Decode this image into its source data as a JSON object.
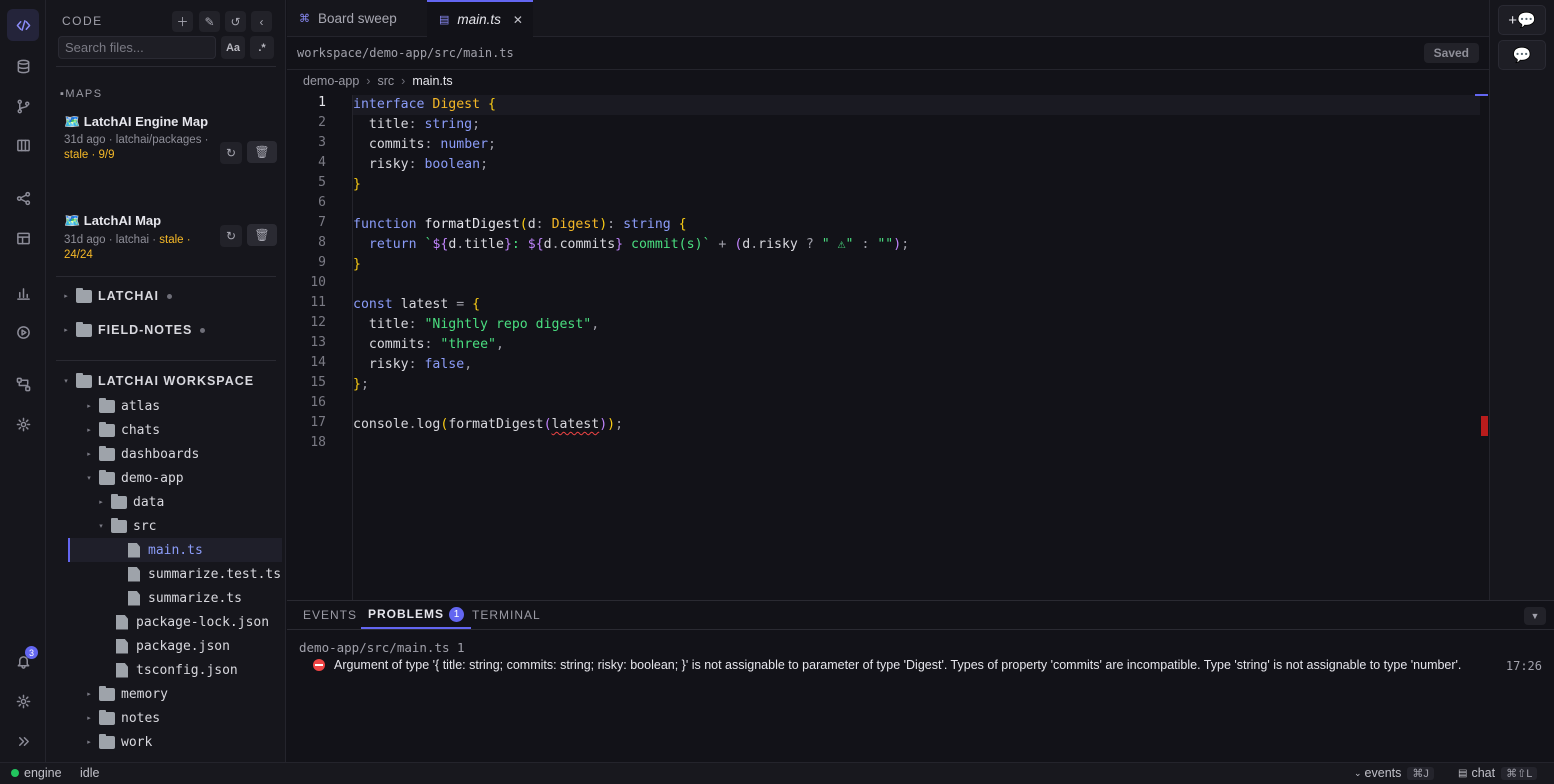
{
  "activity_bar": {
    "items": [
      "code-icon",
      "database-icon",
      "git-branch-icon",
      "board-icon",
      "share-icon",
      "dashboard-icon",
      "chart-icon",
      "play-icon",
      "flow-icon",
      "gear-icon"
    ],
    "notifications_count": "3"
  },
  "sidebar": {
    "title": "CODE",
    "search_placeholder": "Search files...",
    "match_case": "Aa",
    "regex": ".*",
    "maps_label": "MAPS",
    "maps": [
      {
        "title": "🗺️ LatchAI Engine Map",
        "meta_prefix": "31d ago · latchai/packages · ",
        "stale": "stale",
        "meta_sep": " · ",
        "count": "9/9"
      },
      {
        "title": "🗺️ LatchAI Map",
        "meta_prefix": "31d ago · latchai · ",
        "stale": "stale",
        "meta_sep": " · ",
        "count": "24/24"
      }
    ],
    "groups": [
      "LATCHAI",
      "FIELD-NOTES",
      "LATCHAI WORKSPACE"
    ],
    "tree": [
      {
        "label": "atlas"
      },
      {
        "label": "chats"
      },
      {
        "label": "dashboards"
      },
      {
        "label": "demo-app"
      },
      {
        "label": "data"
      },
      {
        "label": "src"
      },
      {
        "label": "main.ts"
      },
      {
        "label": "summarize.test.ts"
      },
      {
        "label": "summarize.ts"
      },
      {
        "label": "package-lock.json"
      },
      {
        "label": "package.json"
      },
      {
        "label": "tsconfig.json"
      },
      {
        "label": "memory"
      },
      {
        "label": "notes"
      },
      {
        "label": "work"
      }
    ]
  },
  "tabs": [
    {
      "label": "Board sweep"
    },
    {
      "label": "main.ts",
      "close": "✕"
    }
  ],
  "pathbar": {
    "path": "workspace/demo-app/src/main.ts",
    "status": "Saved"
  },
  "breadcrumb": [
    "demo-app",
    "src",
    "main.ts"
  ],
  "editor": {
    "line_numbers": [
      "1",
      "2",
      "3",
      "4",
      "5",
      "6",
      "7",
      "8",
      "9",
      "10",
      "11",
      "12",
      "13",
      "14",
      "15",
      "16",
      "17",
      "18"
    ],
    "current_line": "1"
  },
  "panel": {
    "tabs": [
      "EVENTS",
      "PROBLEMS",
      "TERMINAL"
    ],
    "problems_count": "1",
    "file": "demo-app/src/main.ts 1",
    "error_message": "Argument of type '{ title: string; commits: string; risky: boolean; }' is not assignable to parameter of type 'Digest'. Types of property 'commits' are incompatible. Type 'string' is not assignable to type 'number'.",
    "error_position": "17:26"
  },
  "statusbar": {
    "engine": "engine",
    "state": "idle",
    "events": "events",
    "events_key": "⌘J",
    "chat": "chat",
    "chat_key": "⌘⇧L"
  },
  "colors": {
    "accent": "#6366f1",
    "stale": "#f5b827",
    "error": "#ef4444",
    "online": "#22c55e"
  }
}
